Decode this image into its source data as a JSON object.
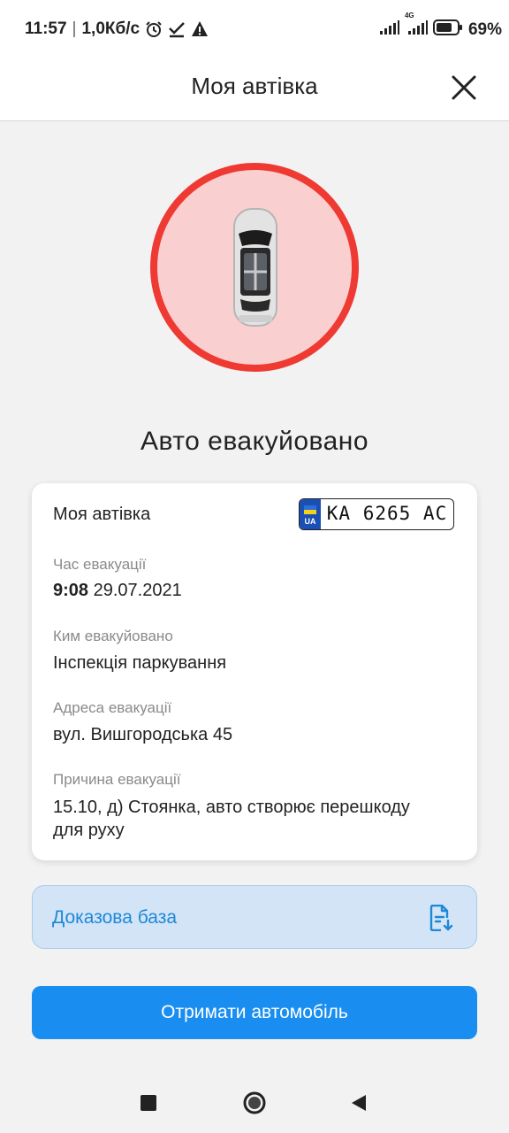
{
  "status_bar": {
    "time": "11:57",
    "network_speed": "1,0Кб/с",
    "battery_percent": "69%",
    "network_type": "4G",
    "icons": [
      "alarm-icon",
      "check-icon",
      "warning-icon",
      "signal-icon",
      "signal-4g-icon",
      "battery-icon"
    ]
  },
  "header": {
    "title": "Моя автівка",
    "close_icon": "close-icon"
  },
  "hero": {
    "icon": "car-top-view-icon",
    "circle_color": "#ee3a33",
    "circle_fill": "#f9d0cf"
  },
  "status_title": "Авто евакуйовано",
  "card": {
    "title": "Моя автівка",
    "plate": {
      "country": "UA",
      "number": "KA 6265 AC"
    },
    "fields": [
      {
        "label": "Час евакуації",
        "time": "9:08",
        "date": "29.07.2021"
      },
      {
        "label": "Ким евакуйовано",
        "value": "Інспекція паркування"
      },
      {
        "label": "Адреса евакуації",
        "value": "вул. Вишгородська 45"
      },
      {
        "label": "Причина евакуації",
        "value_line1": "15.10, д) Стоянка, авто створює перешкоду",
        "value_line2": "для руху"
      }
    ]
  },
  "evidence": {
    "label": "Доказова база",
    "icon": "document-download-icon",
    "color": "#1e88d8"
  },
  "primary_button": {
    "label": "Отримати автомобіль",
    "color": "#1a8ef0"
  },
  "nav_bar": {
    "recents_icon": "square-icon",
    "home_icon": "circle-icon",
    "back_icon": "triangle-back-icon"
  }
}
